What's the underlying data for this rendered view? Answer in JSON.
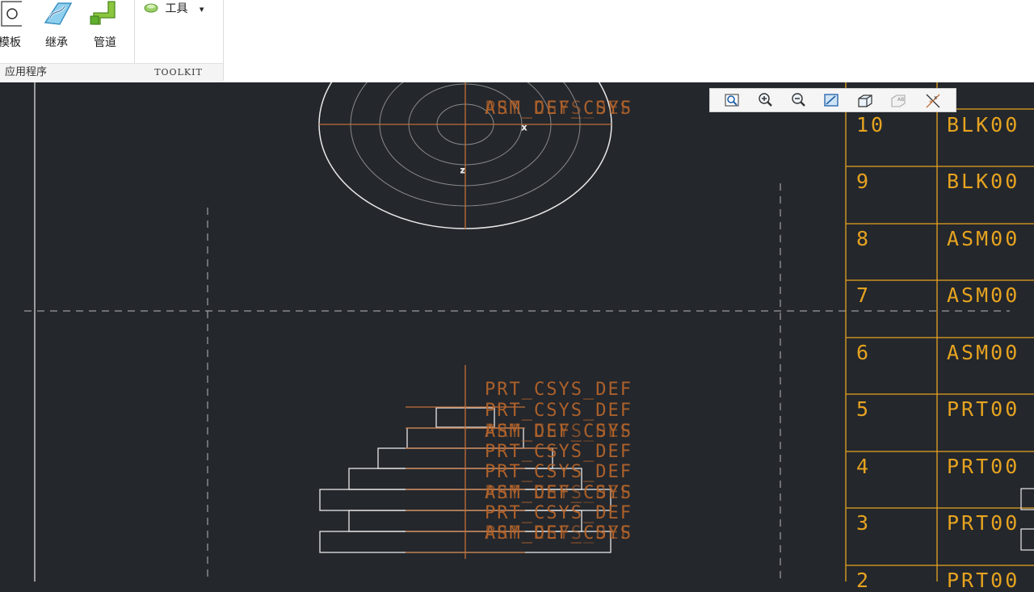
{
  "ribbon": {
    "buttons": [
      {
        "label": "模板",
        "icon": "template-icon"
      },
      {
        "label": "继承",
        "icon": "inheritance-icon"
      },
      {
        "label": "管道",
        "icon": "pipe-icon"
      }
    ],
    "tools_menu": {
      "label": "工具",
      "icon": "tools-icon",
      "caret": "▾"
    },
    "groups": [
      "应用程序",
      "TOOLKIT"
    ]
  },
  "view_toolbar": {
    "buttons": [
      "refit-icon",
      "zoom-in-icon",
      "zoom-out-icon",
      "repaint-icon",
      "display-style-icon",
      "named-view-icon",
      "datum-display-icon"
    ]
  },
  "drawing": {
    "labels": {
      "prt_csys": "PRT_CSYS_DEF",
      "asm_csys": "ASM_DEF_CSYS"
    },
    "bom_table": {
      "rows": [
        {
          "index": "10",
          "name": "BLK00"
        },
        {
          "index": "9",
          "name": "BLK00"
        },
        {
          "index": "8",
          "name": "ASM00"
        },
        {
          "index": "7",
          "name": "ASM00"
        },
        {
          "index": "6",
          "name": "ASM00"
        },
        {
          "index": "5",
          "name": "PRT00"
        },
        {
          "index": "4",
          "name": "PRT00"
        },
        {
          "index": "3",
          "name": "PRT00"
        },
        {
          "index": "2",
          "name": "PRT00"
        }
      ]
    }
  },
  "colors": {
    "background": "#24272c",
    "geometry": "#e8e8e8",
    "table": "#e6a320",
    "datum": "#b7652a"
  }
}
